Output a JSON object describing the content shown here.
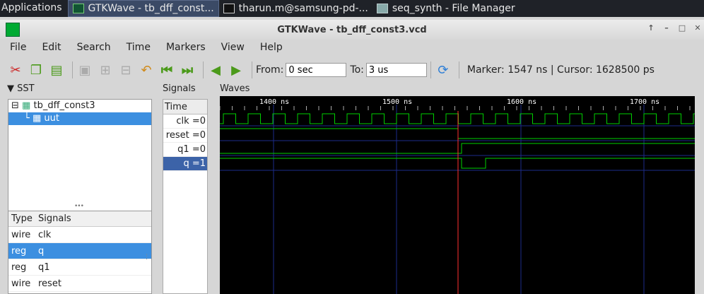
{
  "taskbar": {
    "applications": "Applications",
    "tasks": [
      {
        "label": "GTKWave - tb_dff_const...",
        "icon": "gtkwave-icon",
        "active": true
      },
      {
        "label": "tharun.m@samsung-pd-...",
        "icon": "terminal-icon",
        "active": false
      },
      {
        "label": "seq_synth - File Manager",
        "icon": "folder-icon",
        "active": false
      }
    ]
  },
  "window": {
    "title": "GTKWave - tb_dff_const3.vcd",
    "controls": [
      "↑",
      "–",
      "□",
      "✕"
    ]
  },
  "menu": [
    "File",
    "Edit",
    "Search",
    "Time",
    "Markers",
    "View",
    "Help"
  ],
  "toolbar": {
    "from_label": "From:",
    "from_value": "0 sec",
    "to_label": "To:",
    "to_value": "3 us",
    "marker_text": "Marker: 1547 ns  |  Cursor: 1628500 ps"
  },
  "sst": {
    "header": "▼ SST",
    "tree": [
      {
        "label": "tb_dff_const3",
        "selected": false
      },
      {
        "label": "uut",
        "selected": true
      }
    ],
    "columns": [
      "Type",
      "Signals"
    ],
    "rows": [
      {
        "type": "wire",
        "name": "clk",
        "selected": false
      },
      {
        "type": "reg",
        "name": "q",
        "selected": true
      },
      {
        "type": "reg",
        "name": "q1",
        "selected": false
      },
      {
        "type": "wire",
        "name": "reset",
        "selected": false
      }
    ]
  },
  "signals": {
    "header": "Signals",
    "time_label": "Time",
    "rows": [
      {
        "label": "clk =0",
        "selected": false
      },
      {
        "label": "reset =0",
        "selected": false
      },
      {
        "label": "q1 =0",
        "selected": false
      },
      {
        "label": "q =1",
        "selected": true
      }
    ]
  },
  "waves": {
    "header": "Waves",
    "ticks": [
      "1400 ns",
      "1500 ns",
      "1600 ns",
      "1700 ns"
    ],
    "colors": {
      "bg": "#000000",
      "wave": "#00d000",
      "marker": "#ff3030",
      "grid": "#1c2b8a"
    }
  }
}
